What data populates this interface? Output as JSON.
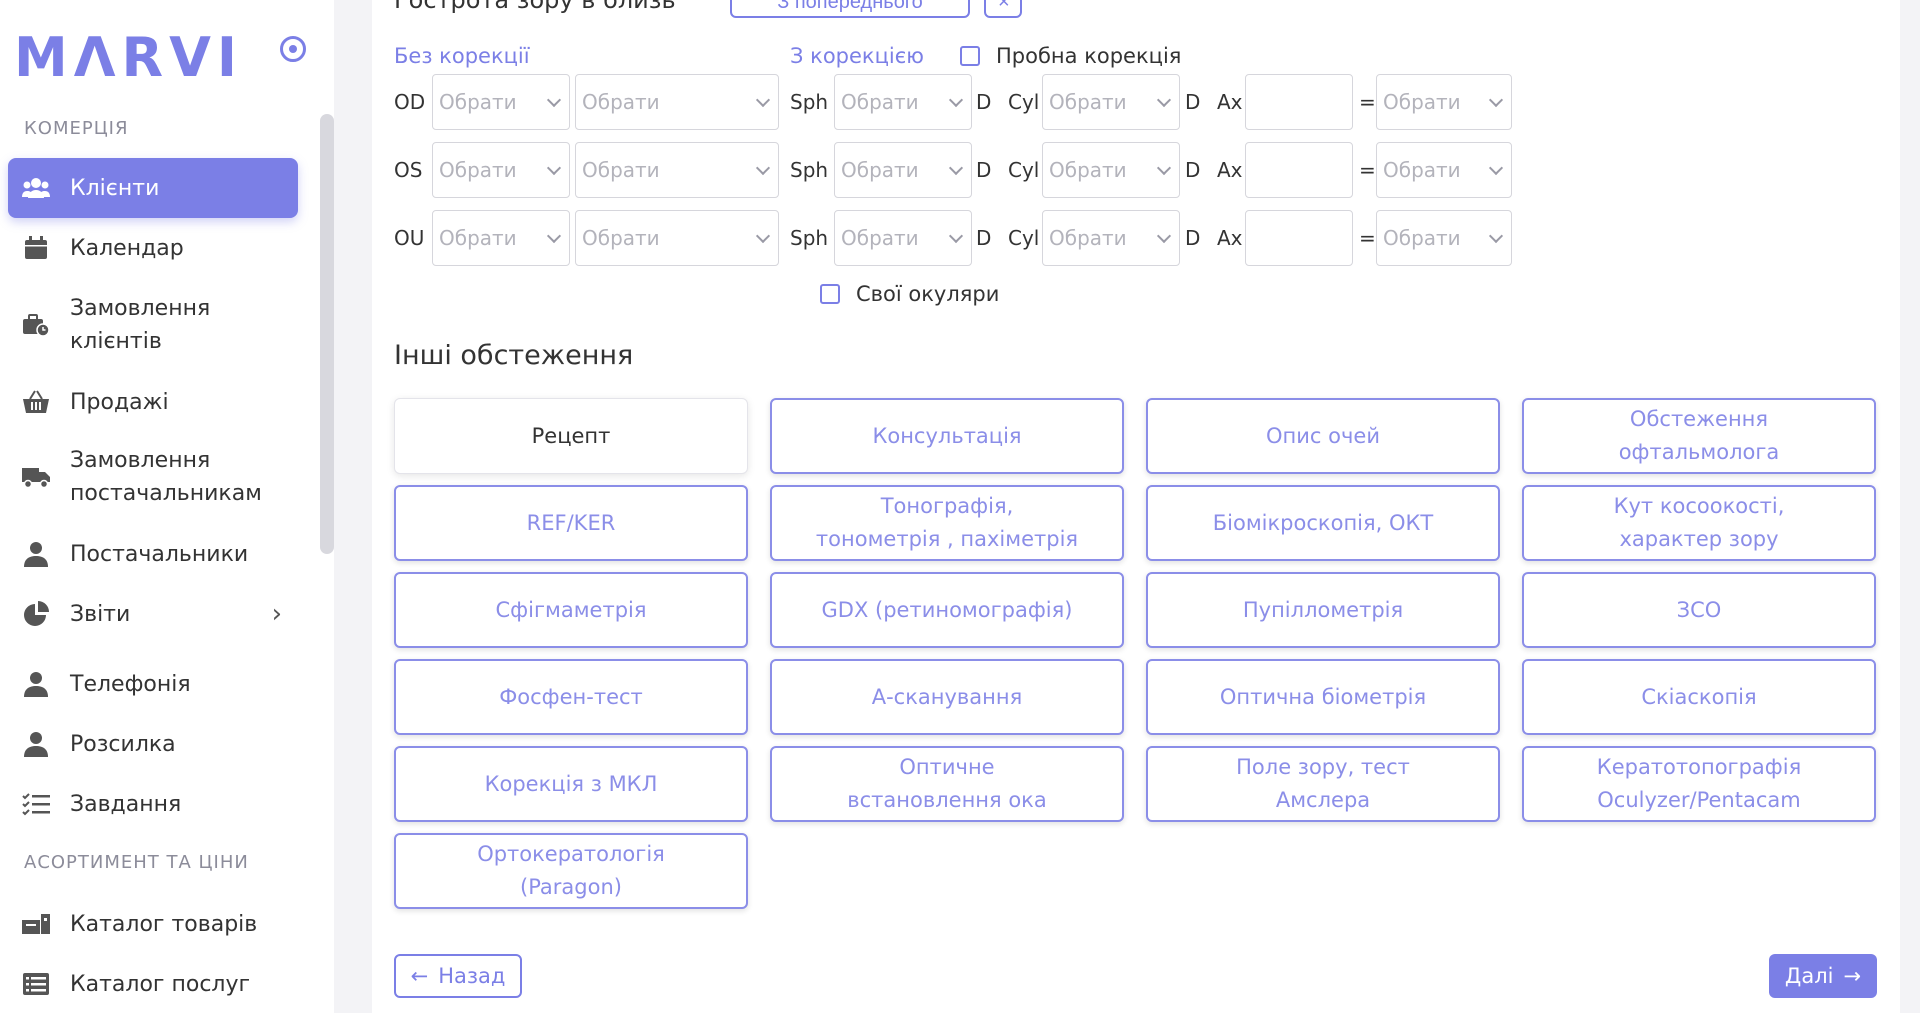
{
  "brand": {
    "logo": "MΛRVI",
    "accent": "#7b7fe6"
  },
  "sidebar": {
    "sections": [
      "КОМЕРЦІЯ",
      "АСОРТИМЕНТ ТА ЦІНИ"
    ],
    "items": [
      {
        "label": "Клієнти",
        "icon": "users-icon",
        "active": true
      },
      {
        "label": "Календар",
        "icon": "calendar-icon"
      },
      {
        "label": "Замовлення\nклієнтів",
        "icon": "briefcase-clock-icon"
      },
      {
        "label": "Продажі",
        "icon": "basket-icon"
      },
      {
        "label": "Замовлення\nпостачальникам",
        "icon": "truck-icon"
      },
      {
        "label": "Постачальники",
        "icon": "person-icon"
      },
      {
        "label": "Звіти",
        "icon": "pie-chart-icon",
        "expandable": true
      },
      {
        "label": "Телефонія",
        "icon": "person-icon"
      },
      {
        "label": "Розсилка",
        "icon": "person-icon"
      },
      {
        "label": "Завдання",
        "icon": "task-list-icon"
      },
      {
        "label": "Каталог товарів",
        "icon": "catalog-icon"
      },
      {
        "label": "Каталог послуг",
        "icon": "list-icon"
      }
    ]
  },
  "main": {
    "scrolled_title": "Гострота зору в близь",
    "copy_prev_label": "З попереднього",
    "close_label": "×",
    "no_correction_label": "Без корекції",
    "with_correction_label": "З корекцією",
    "trial_correction_label": "Пробна корекція",
    "own_glasses_label": "Свої окуляри",
    "placeholder": "Обрати",
    "sph_label": "Sph",
    "d_label": "D",
    "cyl_label": "Cyl",
    "ax_label": "Ax",
    "eq_label": "=",
    "rows": [
      "OD",
      "OS",
      "OU"
    ],
    "other_exams_title": "Інші обстеження",
    "exams": [
      "Рецепт",
      "Консультація",
      "Опис очей",
      "Обстеження\nофтальмолога",
      "REF/KER",
      "Тонографія,\nтонометрія , пахіметрія",
      "Біомікроскопія, ОКТ",
      "Кут косоокості,\nхарактер зору",
      "Сфігмаметрія",
      "GDX (ретиномографія)",
      "Пупіллометрія",
      "ЗСО",
      "Фосфен-тест",
      "А-сканування",
      "Оптична біометрія",
      "Скіаскопія",
      "Корекція з МКЛ",
      "Оптичне\nвстановлення ока",
      "Поле зору, тест\nАмслера",
      "Кератотопографія\nOculyzer/Pentacam",
      "Ортокератологія\n(Paragon)"
    ],
    "back_label": "Назад",
    "next_label": "Далі"
  }
}
